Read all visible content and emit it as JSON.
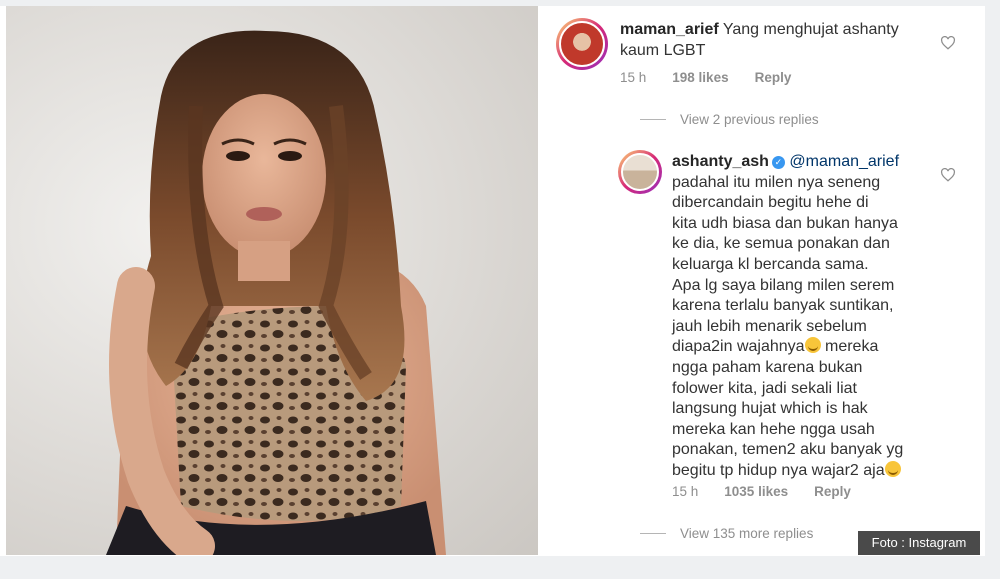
{
  "comment1": {
    "username": "maman_arief",
    "text_line1": "Yang menghujat ashanty",
    "text_line2": "kaum LGBT",
    "time": "15 h",
    "likes": "198 likes",
    "reply": "Reply"
  },
  "view_previous": "View 2 previous replies",
  "comment2": {
    "username": "ashanty_ash",
    "mention": "@maman_arief",
    "lines": [
      "padahal itu milen nya seneng",
      "dibercandain begitu hehe di",
      "kita udh biasa dan bukan hanya",
      "ke dia, ke semua ponakan dan",
      "keluarga kl bercanda sama.",
      "Apa lg saya bilang milen serem",
      "karena terlalu banyak suntikan,",
      "jauh lebih menarik sebelum",
      "diapa2in wajahnya",
      "mereka",
      "ngga paham karena bukan",
      "folower kita, jadi sekali liat",
      "langsung hujat which is hak",
      "mereka kan hehe ngga usah",
      "ponakan, temen2 aku banyak yg",
      "begitu tp hidup nya wajar2 aja"
    ],
    "time": "15 h",
    "likes": "1035 likes",
    "reply": "Reply"
  },
  "view_more": "View 135 more replies",
  "credit": "Foto : Instagram",
  "icons": {
    "like": "heart-icon",
    "verified": "verified-badge-icon",
    "emoji": "grinning-emoji-icon"
  }
}
